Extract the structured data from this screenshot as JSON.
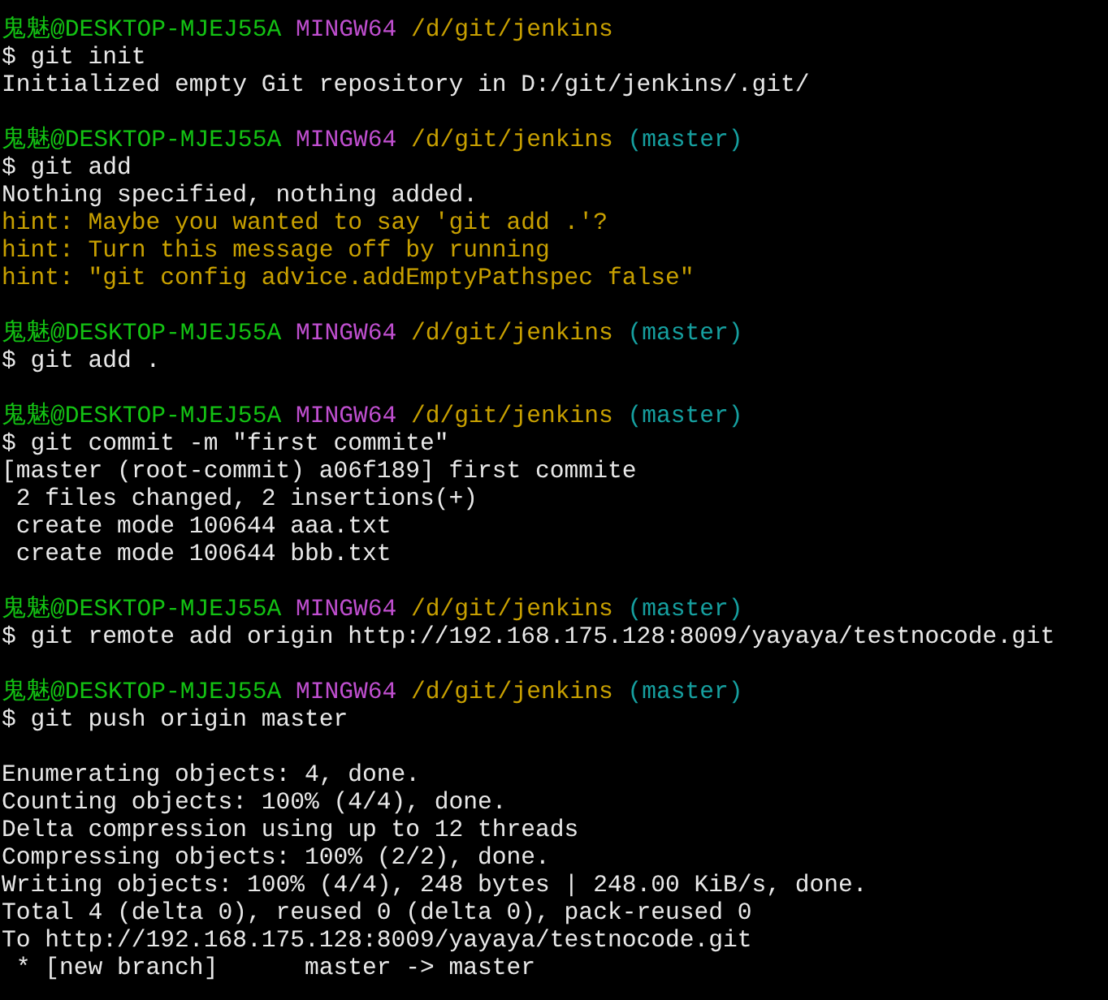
{
  "terminal": {
    "lines": [
      {
        "kind": "prompt",
        "user": "鬼魅@DESKTOP-MJEJ55A",
        "shell": "MINGW64",
        "path": "/d/git/jenkins"
      },
      {
        "kind": "command",
        "text": "$ git init"
      },
      {
        "kind": "output",
        "text": "Initialized empty Git repository in D:/git/jenkins/.git/"
      },
      {
        "kind": "blank"
      },
      {
        "kind": "prompt",
        "user": "鬼魅@DESKTOP-MJEJ55A",
        "shell": "MINGW64",
        "path": "/d/git/jenkins",
        "branch": "(master)"
      },
      {
        "kind": "command",
        "text": "$ git add"
      },
      {
        "kind": "output",
        "text": "Nothing specified, nothing added."
      },
      {
        "kind": "hint",
        "text": "hint: Maybe you wanted to say 'git add .'?"
      },
      {
        "kind": "hint",
        "text": "hint: Turn this message off by running"
      },
      {
        "kind": "hint",
        "text": "hint: \"git config advice.addEmptyPathspec false\""
      },
      {
        "kind": "blank"
      },
      {
        "kind": "prompt",
        "user": "鬼魅@DESKTOP-MJEJ55A",
        "shell": "MINGW64",
        "path": "/d/git/jenkins",
        "branch": "(master)"
      },
      {
        "kind": "command",
        "text": "$ git add ."
      },
      {
        "kind": "blank"
      },
      {
        "kind": "prompt",
        "user": "鬼魅@DESKTOP-MJEJ55A",
        "shell": "MINGW64",
        "path": "/d/git/jenkins",
        "branch": "(master)"
      },
      {
        "kind": "command",
        "text": "$ git commit -m \"first commite\""
      },
      {
        "kind": "output",
        "text": "[master (root-commit) a06f189] first commite"
      },
      {
        "kind": "output",
        "text": " 2 files changed, 2 insertions(+)"
      },
      {
        "kind": "output",
        "text": " create mode 100644 aaa.txt"
      },
      {
        "kind": "output",
        "text": " create mode 100644 bbb.txt"
      },
      {
        "kind": "blank"
      },
      {
        "kind": "prompt",
        "user": "鬼魅@DESKTOP-MJEJ55A",
        "shell": "MINGW64",
        "path": "/d/git/jenkins",
        "branch": "(master)"
      },
      {
        "kind": "command",
        "text": "$ git remote add origin http://192.168.175.128:8009/yayaya/testnocode.git"
      },
      {
        "kind": "blank"
      },
      {
        "kind": "prompt",
        "user": "鬼魅@DESKTOP-MJEJ55A",
        "shell": "MINGW64",
        "path": "/d/git/jenkins",
        "branch": "(master)"
      },
      {
        "kind": "command",
        "text": "$ git push origin master"
      },
      {
        "kind": "blank"
      },
      {
        "kind": "output",
        "text": "Enumerating objects: 4, done."
      },
      {
        "kind": "output",
        "text": "Counting objects: 100% (4/4), done."
      },
      {
        "kind": "output",
        "text": "Delta compression using up to 12 threads"
      },
      {
        "kind": "output",
        "text": "Compressing objects: 100% (2/2), done."
      },
      {
        "kind": "output",
        "text": "Writing objects: 100% (4/4), 248 bytes | 248.00 KiB/s, done."
      },
      {
        "kind": "output",
        "text": "Total 4 (delta 0), reused 0 (delta 0), pack-reused 0"
      },
      {
        "kind": "output",
        "text": "To http://192.168.175.128:8009/yayaya/testnocode.git"
      },
      {
        "kind": "output",
        "text": " * [new branch]      master -> master"
      }
    ]
  }
}
